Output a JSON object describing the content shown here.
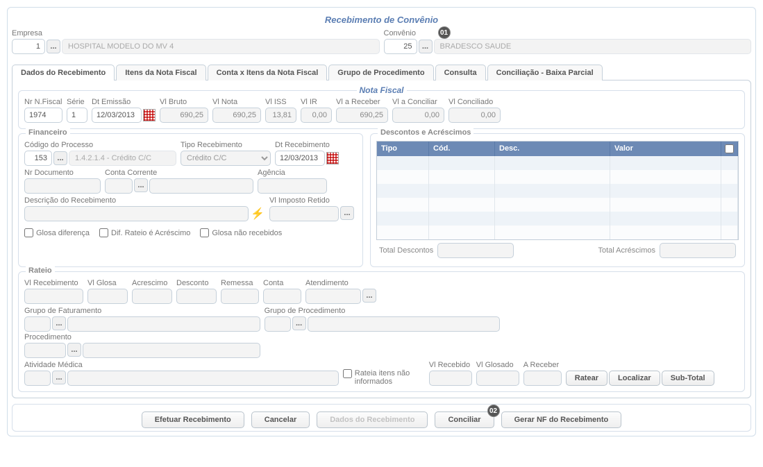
{
  "title": "Recebimento de Convênio",
  "header": {
    "empresa_label": "Empresa",
    "empresa_value": "1",
    "empresa_name": "HOSPITAL MODELO DO MV 4",
    "convenio_label": "Convênio",
    "convenio_value": "25",
    "convenio_name": "BRADESCO SAUDE"
  },
  "badges": {
    "b1": "01",
    "b2": "02"
  },
  "tabs": [
    "Dados do Recebimento",
    "Itens da Nota Fiscal",
    "Conta x Itens da Nota Fiscal",
    "Grupo de Procedimento",
    "Consulta",
    "Conciliação - Baixa Parcial"
  ],
  "nota_fiscal": {
    "legend": "Nota Fiscal",
    "nr_label": "Nr N.Fiscal",
    "nr_value": "1974",
    "serie_label": "Série",
    "serie_value": "1",
    "dt_emissao_label": "Dt Emissão",
    "dt_emissao_value": "12/03/2013",
    "vl_bruto_label": "Vl Bruto",
    "vl_bruto_value": "690,25",
    "vl_nota_label": "Vl Nota",
    "vl_nota_value": "690,25",
    "vl_iss_label": "Vl ISS",
    "vl_iss_value": "13,81",
    "vl_ir_label": "Vl IR",
    "vl_ir_value": "0,00",
    "vl_receber_label": "Vl a Receber",
    "vl_receber_value": "690,25",
    "vl_conciliar_label": "Vl a Conciliar",
    "vl_conciliar_value": "0,00",
    "vl_conciliado_label": "Vl Conciliado",
    "vl_conciliado_value": "0,00"
  },
  "financeiro": {
    "legend": "Financeiro",
    "codigo_processo_label": "Código do Processo",
    "codigo_processo_value": "153",
    "codigo_processo_desc": "1.4.2.1.4 - Crédito C/C",
    "tipo_recebimento_label": "Tipo Recebimento",
    "tipo_recebimento_value": "Crédito C/C",
    "dt_recebimento_label": "Dt Recebimento",
    "dt_recebimento_value": "12/03/2013",
    "nr_documento_label": "Nr Documento",
    "conta_corrente_label": "Conta Corrente",
    "agencia_label": "Agência",
    "descricao_label": "Descrição do Recebimento",
    "vl_imposto_label": "Vl Imposto Retido",
    "cb_glosa_dif": "Glosa diferença",
    "cb_dif_rateio": "Dif. Rateio é Acréscimo",
    "cb_glosa_nao": "Glosa não recebidos"
  },
  "descontos": {
    "legend": "Descontos e Acréscimos",
    "cols": {
      "tipo": "Tipo",
      "cod": "Cód.",
      "desc": "Desc.",
      "valor": "Valor"
    },
    "total_desc_label": "Total Descontos",
    "total_acr_label": "Total Acréscimos"
  },
  "rateio": {
    "legend": "Rateio",
    "vl_recebimento": "Vl Recebimento",
    "vl_glosa": "Vl Glosa",
    "acrescimo": "Acrescimo",
    "desconto": "Desconto",
    "remessa": "Remessa",
    "conta": "Conta",
    "atendimento": "Atendimento",
    "grupo_fat": "Grupo de Faturamento",
    "grupo_proc": "Grupo de Procedimento",
    "procedimento": "Procedimento",
    "atividade": "Atividade Médica",
    "rateia_itens": "Rateia itens não informados",
    "vl_recebido": "Vl Recebido",
    "vl_glosado": "Vl Glosado",
    "a_receber": "A Receber",
    "btn_ratear": "Ratear",
    "btn_localizar": "Localizar",
    "btn_subtotal": "Sub-Total"
  },
  "actions": {
    "efetuar": "Efetuar Recebimento",
    "cancelar": "Cancelar",
    "dados": "Dados do Recebimento",
    "conciliar": "Conciliar",
    "gerar_nf": "Gerar NF do Recebimento"
  },
  "misc": {
    "ellipsis": "..."
  }
}
